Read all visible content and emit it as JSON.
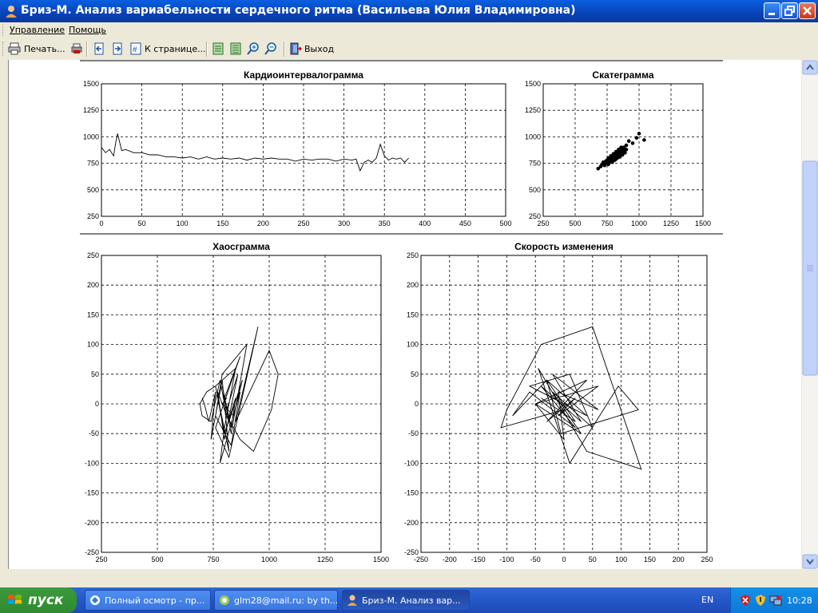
{
  "window": {
    "title": "Бриз-М. Анализ вариабельности сердечного ритма (Васильева Юлия Владимировна)"
  },
  "menu": {
    "items": [
      "Управление",
      "Помощь"
    ]
  },
  "toolbar": {
    "print_label": "Печать...",
    "goto_page_label": "К странице...",
    "exit_label": "Выход"
  },
  "colors": {
    "titlebar": "#0a4fd0",
    "taskbar": "#2557c9",
    "start": "#3c9a3c",
    "client": "#ffffff"
  },
  "chart_data": [
    {
      "type": "line",
      "title": "Кардиоинтервалограмма",
      "xlim": [
        0,
        500
      ],
      "ylim": [
        250,
        1500
      ],
      "x_ticks": [
        0,
        50,
        100,
        150,
        200,
        250,
        300,
        350,
        400,
        450,
        500
      ],
      "y_ticks": [
        1500,
        1250,
        1000,
        750,
        500,
        250
      ],
      "grid": true,
      "series": [
        {
          "x": [
            0,
            5,
            10,
            15,
            18,
            20,
            25,
            30,
            40,
            50,
            60,
            70,
            80,
            90,
            100,
            110,
            120,
            130,
            140,
            150,
            160,
            170,
            180,
            190,
            200,
            210,
            220,
            230,
            240,
            250,
            260,
            270,
            280,
            290,
            300,
            310,
            315,
            320,
            325,
            330,
            335,
            340,
            345,
            350,
            355,
            360,
            365,
            370,
            375,
            380
          ],
          "values": [
            900,
            850,
            880,
            820,
            960,
            1030,
            870,
            880,
            850,
            850,
            830,
            830,
            810,
            810,
            800,
            810,
            790,
            810,
            790,
            800,
            790,
            800,
            780,
            800,
            790,
            800,
            790,
            790,
            770,
            790,
            780,
            790,
            790,
            770,
            790,
            780,
            790,
            680,
            760,
            780,
            760,
            800,
            930,
            820,
            780,
            800,
            790,
            800,
            760,
            800
          ]
        }
      ]
    },
    {
      "type": "scatter",
      "title": "Скатеграмма",
      "xlim": [
        250,
        1500
      ],
      "ylim": [
        250,
        1500
      ],
      "x_ticks": [
        250,
        500,
        750,
        1000,
        1250,
        1500
      ],
      "y_ticks": [
        1500,
        1250,
        1000,
        750,
        500,
        250
      ],
      "grid": true,
      "points": [
        [
          680,
          700
        ],
        [
          700,
          720
        ],
        [
          720,
          760
        ],
        [
          740,
          750
        ],
        [
          750,
          780
        ],
        [
          760,
          770
        ],
        [
          770,
          800
        ],
        [
          780,
          790
        ],
        [
          790,
          810
        ],
        [
          800,
          820
        ],
        [
          810,
          800
        ],
        [
          820,
          830
        ],
        [
          830,
          820
        ],
        [
          840,
          850
        ],
        [
          850,
          840
        ],
        [
          860,
          870
        ],
        [
          870,
          860
        ],
        [
          880,
          900
        ],
        [
          760,
          740
        ],
        [
          770,
          760
        ],
        [
          780,
          770
        ],
        [
          790,
          790
        ],
        [
          800,
          780
        ],
        [
          810,
          820
        ],
        [
          820,
          810
        ],
        [
          830,
          840
        ],
        [
          840,
          830
        ],
        [
          850,
          860
        ],
        [
          860,
          850
        ],
        [
          740,
          770
        ],
        [
          750,
          760
        ],
        [
          730,
          730
        ],
        [
          710,
          740
        ],
        [
          760,
          800
        ],
        [
          780,
          820
        ],
        [
          800,
          840
        ],
        [
          820,
          860
        ],
        [
          840,
          880
        ],
        [
          860,
          900
        ],
        [
          880,
          880
        ],
        [
          900,
          920
        ],
        [
          920,
          960
        ],
        [
          950,
          940
        ],
        [
          980,
          990
        ],
        [
          1000,
          1030
        ],
        [
          1040,
          970
        ],
        [
          820,
          790
        ],
        [
          830,
          800
        ],
        [
          790,
          760
        ],
        [
          810,
          780
        ],
        [
          850,
          810
        ],
        [
          870,
          830
        ],
        [
          890,
          850
        ],
        [
          900,
          880
        ]
      ]
    },
    {
      "type": "line",
      "title": "Хаосграмма",
      "xlim": [
        250,
        1500
      ],
      "ylim": [
        -250,
        250
      ],
      "x_ticks": [
        250,
        500,
        750,
        1000,
        1250,
        1500
      ],
      "y_ticks": [
        250,
        200,
        150,
        100,
        50,
        0,
        -50,
        -100,
        -150,
        -200,
        -250
      ],
      "grid": true,
      "series": [
        {
          "x": [
            700,
            710,
            730,
            760,
            740,
            790,
            820,
            760,
            850,
            800,
            780,
            870,
            830,
            760,
            790,
            900,
            830,
            800,
            870,
            760,
            820,
            950,
            850,
            1000,
            1040,
            1010,
            930,
            870,
            810,
            780,
            740,
            700,
            690,
            720,
            760,
            800,
            850,
            830,
            790,
            810,
            860,
            800,
            770,
            820,
            880,
            840,
            790,
            810
          ],
          "values": [
            10,
            0,
            -30,
            20,
            -60,
            40,
            -80,
            30,
            60,
            -40,
            -100,
            20,
            -70,
            -20,
            50,
            100,
            -50,
            10,
            80,
            -40,
            -90,
            130,
            -30,
            90,
            50,
            -10,
            -80,
            -60,
            -20,
            40,
            -30,
            -20,
            0,
            20,
            30,
            -50,
            10,
            -40,
            30,
            -10,
            50,
            -60,
            20,
            -30,
            40,
            -20,
            0,
            10
          ]
        }
      ]
    },
    {
      "type": "line",
      "title": "Скорость изменения",
      "xlim": [
        -250,
        250
      ],
      "ylim": [
        -250,
        250
      ],
      "x_ticks": [
        -250,
        -200,
        -150,
        -100,
        -50,
        0,
        50,
        100,
        150,
        200,
        250
      ],
      "y_ticks": [
        250,
        200,
        150,
        100,
        50,
        0,
        -50,
        -100,
        -150,
        -200,
        -250
      ],
      "grid": true,
      "series": [
        {
          "x": [
            -40,
            20,
            -30,
            40,
            -60,
            10,
            50,
            -20,
            30,
            -50,
            60,
            -10,
            0,
            -110,
            -100,
            -40,
            50,
            135,
            40,
            -45,
            10,
            95,
            130,
            -5,
            -30,
            -90,
            -60,
            20,
            -40,
            30,
            -20,
            60,
            -10,
            0,
            -50,
            40,
            -30,
            20,
            -10,
            10
          ],
          "values": [
            10,
            -30,
            40,
            -20,
            30,
            50,
            -40,
            20,
            -50,
            0,
            30,
            -20,
            -10,
            -40,
            -10,
            100,
            130,
            -110,
            -80,
            60,
            -100,
            30,
            -10,
            -50,
            40,
            -20,
            20,
            -40,
            30,
            -30,
            50,
            -10,
            20,
            -60,
            0,
            40,
            -30,
            10,
            -20,
            0
          ]
        }
      ]
    }
  ]
}
